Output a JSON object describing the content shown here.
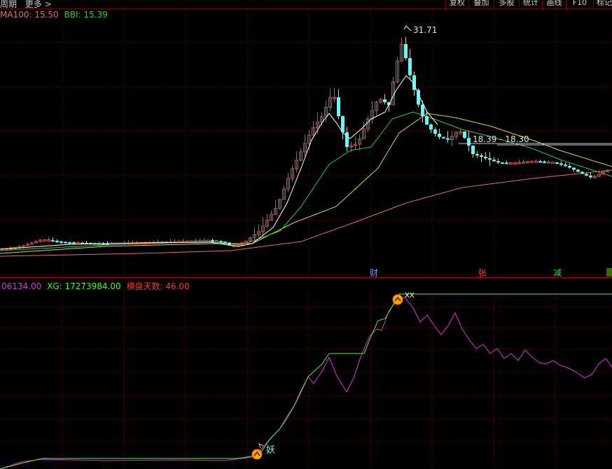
{
  "toolbar": {
    "left_items": [
      "周期",
      "更多 >"
    ],
    "buttons": [
      "复权",
      "叠加",
      "多股",
      "统计",
      "画线",
      "F10",
      "标记"
    ]
  },
  "main_legend": {
    "ma100": "MA100: 15.50",
    "bbi": "BBI: 15.39"
  },
  "price_labels": {
    "peak_high": "31.71",
    "range_label": "18.39 - 18.30"
  },
  "event_markers": [
    "财",
    "张",
    "减"
  ],
  "sub_legend": {
    "first": "06134.00",
    "xg": "XG: 17273984.00",
    "hengpan": "横盘天数: 46.00"
  },
  "signals": {
    "yao_text": "妖",
    "top_text": "XX"
  },
  "colors": {
    "background": "#000000",
    "grid": "#8b0000",
    "up_candle": "#ff3a3a",
    "down_candle": "#54ffff",
    "bbi_line": "#ffffff",
    "ma_green": "#33cc33",
    "ma_yellow": "#d8d83a",
    "ma100_line": "#e07070",
    "indicator_magenta": "#dd33dd",
    "indicator_green": "#55ee33",
    "label_red": "#ff3333",
    "label_cyan": "#54ffff"
  }
}
